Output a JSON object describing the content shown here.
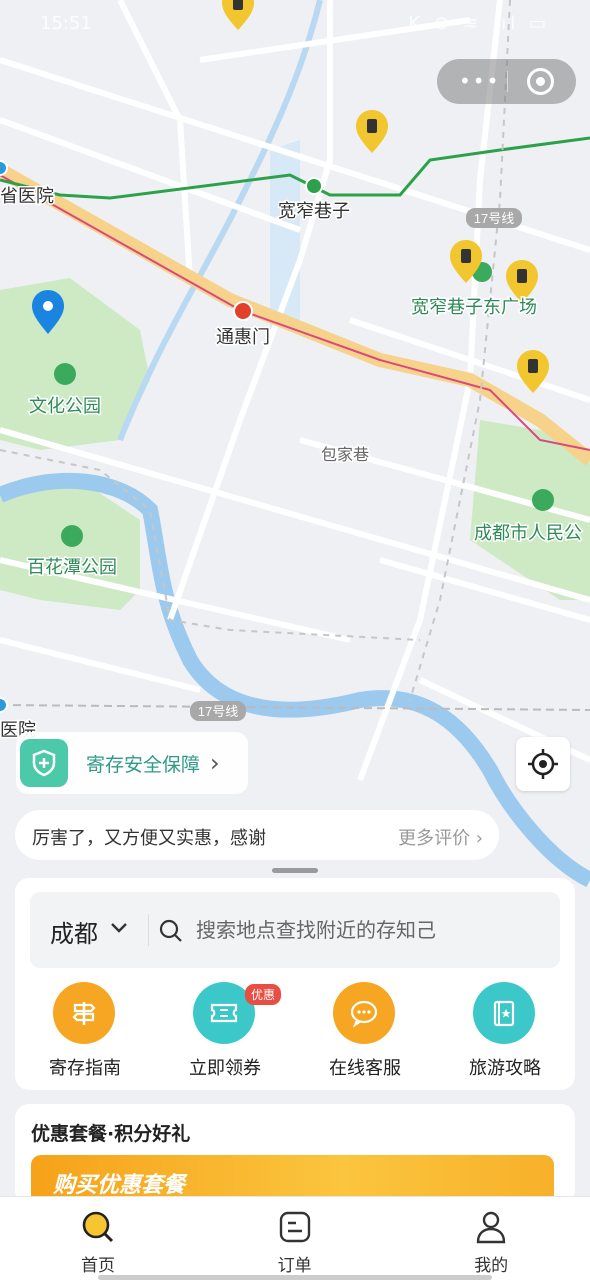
{
  "status_bar": {
    "time": "15:51",
    "indicators": "K ⊙ ≋ .ıl ▭"
  },
  "capsule": {
    "more": "•••",
    "close_icon": "target-icon"
  },
  "map": {
    "labels": {
      "hospital_top": "省医院",
      "kuanzhai": "宽窄巷子",
      "line17_top": "17号线",
      "kuanzhai_east": "宽窄巷子东广场",
      "tonghuimen": "通惠门",
      "wenhua_park": "文化公园",
      "baojia": "包家巷",
      "renmin_park": "成都市人民公",
      "baihuatan": "百花潭公园",
      "line17_bottom": "17号线",
      "hospital_bottom": "科医院"
    },
    "colors": {
      "line_green": "#2da14a",
      "line_pink": "#d9487e",
      "road_yellow": "#f6d28a",
      "park": "#cdeac4",
      "river": "#9cc9ee",
      "pin": "#f1c62f"
    }
  },
  "safety": {
    "label": "寄存安全保障"
  },
  "review": {
    "text": "厉害了，又方便又实惠，感谢",
    "more": "更多评价"
  },
  "search": {
    "city": "成都",
    "placeholder": "搜索地点查找附近的存知己"
  },
  "services": [
    {
      "label": "寄存指南",
      "icon": "signpost-icon",
      "color": "#f6a623"
    },
    {
      "label": "立即领券",
      "icon": "ticket-icon",
      "color": "#3cc8c8",
      "badge": "优惠"
    },
    {
      "label": "在线客服",
      "icon": "chat-icon",
      "color": "#f6a623"
    },
    {
      "label": "旅游攻略",
      "icon": "guidebook-icon",
      "color": "#3cc8c8"
    }
  ],
  "promo": {
    "title": "优惠套餐·积分好礼",
    "banner": "购买优惠套餐"
  },
  "tabs": [
    {
      "label": "首页",
      "icon": "search-home-icon"
    },
    {
      "label": "订单",
      "icon": "order-icon"
    },
    {
      "label": "我的",
      "icon": "profile-icon"
    }
  ]
}
